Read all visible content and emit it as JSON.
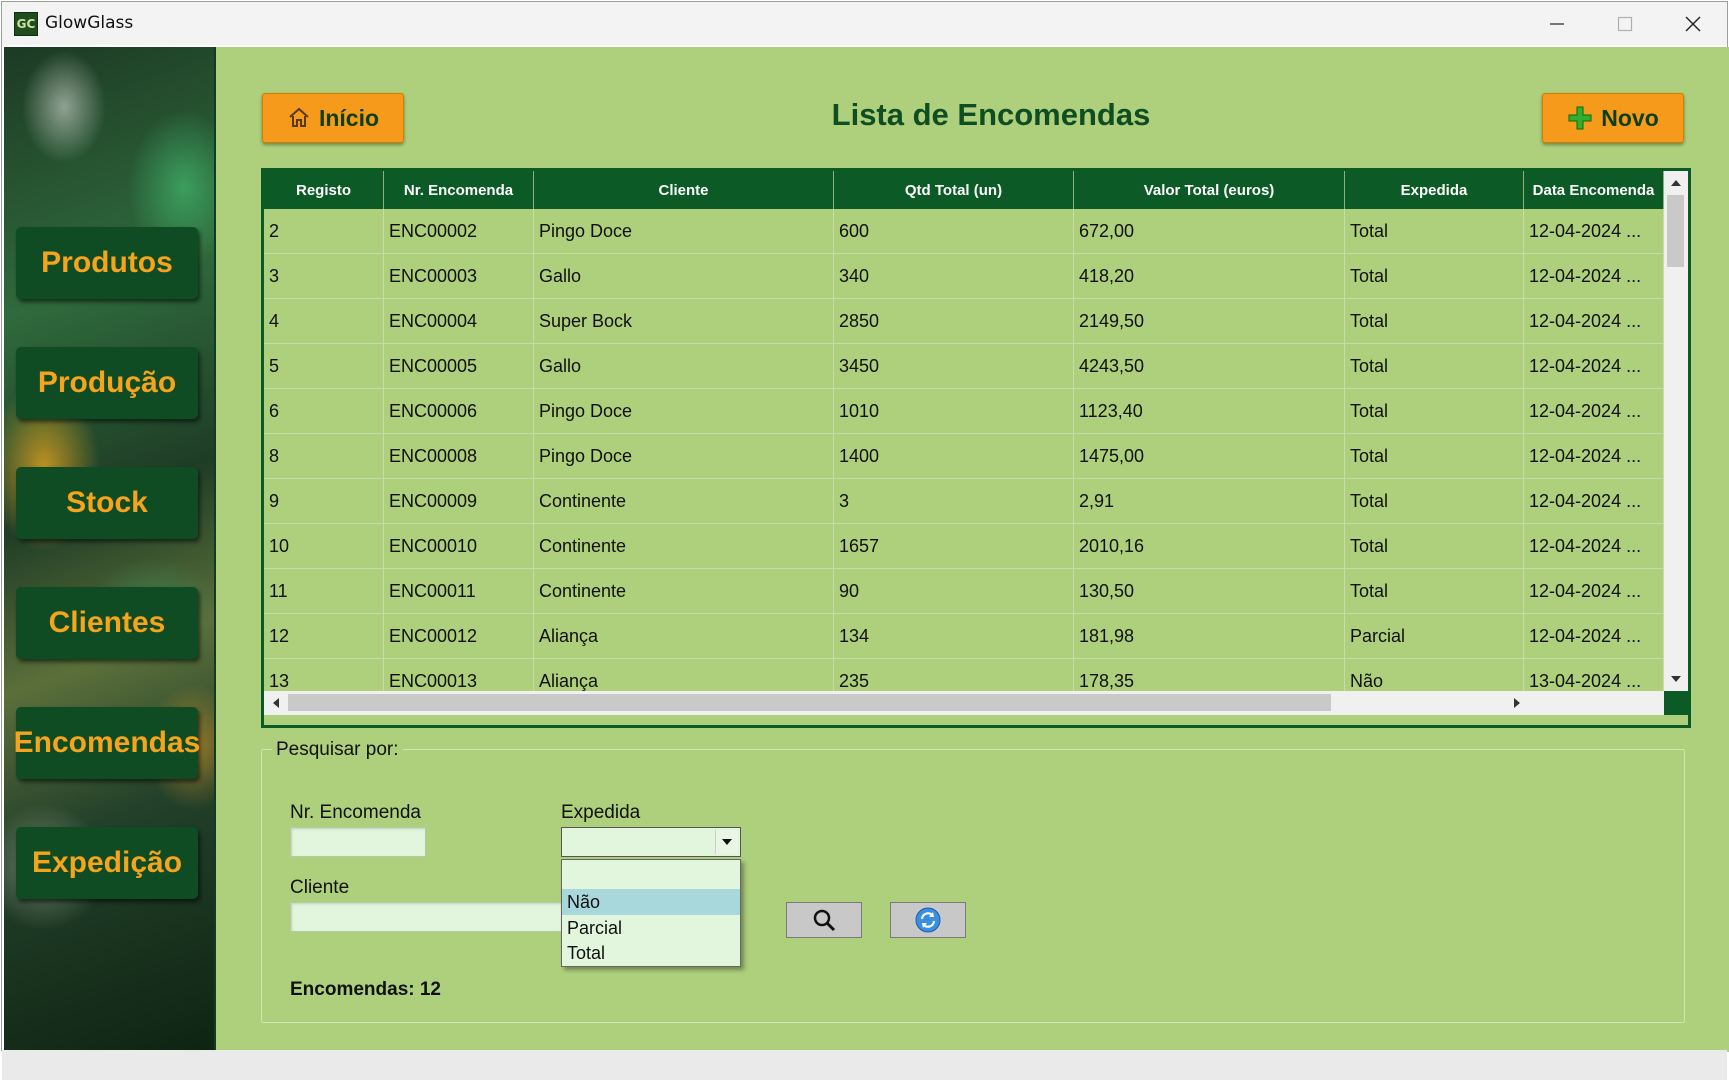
{
  "window": {
    "app_icon_text": "GC",
    "title": "GlowGlass"
  },
  "sidebar": {
    "items": [
      {
        "label": "Produtos"
      },
      {
        "label": "Produção"
      },
      {
        "label": "Stock"
      },
      {
        "label": "Clientes"
      },
      {
        "label": "Encomendas"
      },
      {
        "label": "Expedição"
      }
    ]
  },
  "header": {
    "home_label": "Início",
    "title": "Lista de Encomendas",
    "new_label": "Novo"
  },
  "table": {
    "columns": [
      "Registo",
      "Nr. Encomenda",
      "Cliente",
      "Qtd Total (un)",
      "Valor Total (euros)",
      "Expedida",
      "Data Encomenda"
    ],
    "rows": [
      [
        "2",
        "ENC00002",
        "Pingo Doce",
        "600",
        "672,00",
        "Total",
        "12-04-2024 ..."
      ],
      [
        "3",
        "ENC00003",
        "Gallo",
        "340",
        "418,20",
        "Total",
        "12-04-2024 ..."
      ],
      [
        "4",
        "ENC00004",
        "Super Bock",
        "2850",
        "2149,50",
        "Total",
        "12-04-2024 ..."
      ],
      [
        "5",
        "ENC00005",
        "Gallo",
        "3450",
        "4243,50",
        "Total",
        "12-04-2024 ..."
      ],
      [
        "6",
        "ENC00006",
        "Pingo Doce",
        "1010",
        "1123,40",
        "Total",
        "12-04-2024 ..."
      ],
      [
        "8",
        "ENC00008",
        "Pingo Doce",
        "1400",
        "1475,00",
        "Total",
        "12-04-2024 ..."
      ],
      [
        "9",
        "ENC00009",
        "Continente",
        "3",
        "2,91",
        "Total",
        "12-04-2024 ..."
      ],
      [
        "10",
        "ENC00010",
        "Continente",
        "1657",
        "2010,16",
        "Total",
        "12-04-2024 ..."
      ],
      [
        "11",
        "ENC00011",
        "Continente",
        "90",
        "130,50",
        "Total",
        "12-04-2024 ..."
      ],
      [
        "12",
        "ENC00012",
        "Aliança",
        "134",
        "181,98",
        "Parcial",
        "12-04-2024 ..."
      ],
      [
        "13",
        "ENC00013",
        "Aliança",
        "235",
        "178,35",
        "Não",
        "13-04-2024 ..."
      ]
    ]
  },
  "search": {
    "legend": "Pesquisar por:",
    "order_number_label": "Nr. Encomenda",
    "order_number_value": "",
    "shipped_label": "Expedida",
    "shipped_value": "",
    "shipped_options": [
      "",
      "Não",
      "Parcial",
      "Total"
    ],
    "shipped_highlighted": "Não",
    "client_label": "Cliente",
    "client_value": "",
    "count_text": "Encomendas: 12"
  },
  "icons": {
    "home": "home-icon",
    "new": "plus-icon",
    "search": "search-icon",
    "refresh": "refresh-icon"
  },
  "colors": {
    "background": "#aecf7b",
    "header_green": "#0c5a26",
    "accent_orange": "#f59a1a",
    "sidebar_button": "#0f4b23",
    "input_fill": "#e1f6dc",
    "dropdown_highlight": "#a8d8dc"
  }
}
